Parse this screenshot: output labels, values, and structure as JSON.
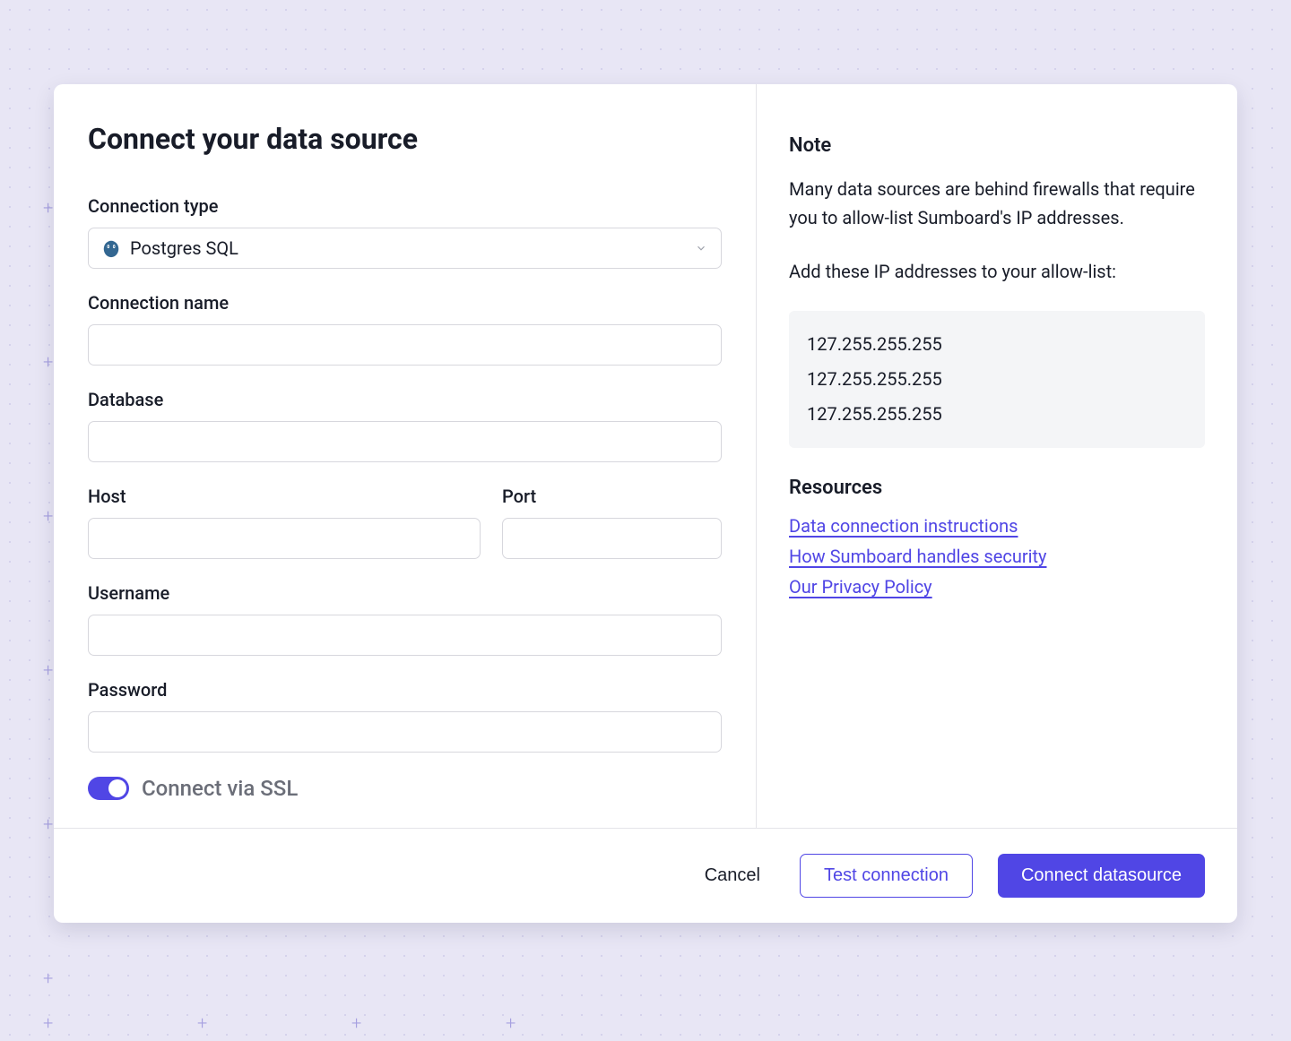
{
  "dialog": {
    "title": "Connect your data source",
    "form": {
      "connection_type": {
        "label": "Connection type",
        "value": "Postgres SQL",
        "icon_name": "postgres-icon"
      },
      "connection_name": {
        "label": "Connection name",
        "value": ""
      },
      "database": {
        "label": "Database",
        "value": ""
      },
      "host": {
        "label": "Host",
        "value": ""
      },
      "port": {
        "label": "Port",
        "value": ""
      },
      "username": {
        "label": "Username",
        "value": ""
      },
      "password": {
        "label": "Password",
        "value": ""
      },
      "ssl_toggle": {
        "label": "Connect via SSL",
        "enabled": true
      }
    },
    "note": {
      "heading": "Note",
      "body1": "Many data sources are behind firewalls that require you to allow-list Sumboard's IP addresses.",
      "body2": "Add these IP addresses to your allow-list:",
      "ips": [
        "127.255.255.255",
        "127.255.255.255",
        "127.255.255.255"
      ]
    },
    "resources": {
      "heading": "Resources",
      "links": [
        "Data connection instructions",
        "How Sumboard handles security",
        "Our Privacy Policy"
      ]
    },
    "footer": {
      "cancel": "Cancel",
      "test": "Test connection",
      "connect": "Connect datasource"
    }
  },
  "colors": {
    "accent": "#5046E5"
  }
}
